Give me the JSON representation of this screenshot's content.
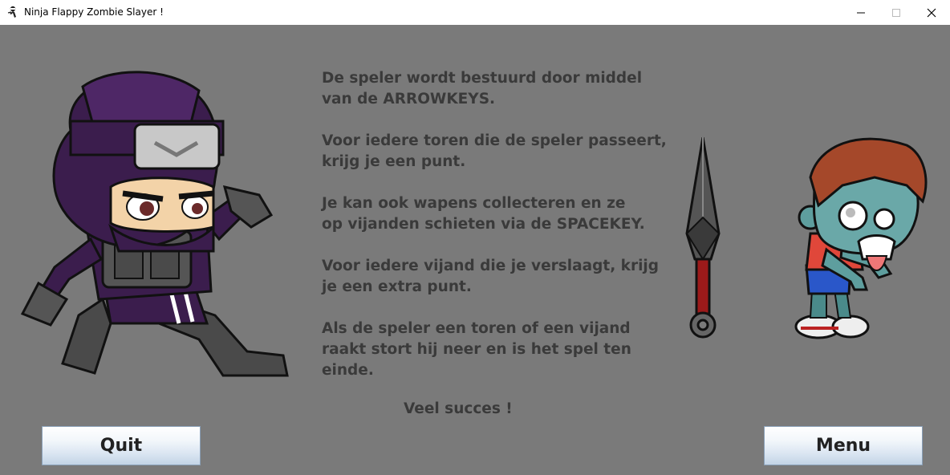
{
  "window": {
    "title": "Ninja Flappy Zombie Slayer !",
    "icon": "ninja-app-icon"
  },
  "instructions": {
    "p1_line1": "De speler wordt bestuurd door middel",
    "p1_line2": "van de ARROWKEYS.",
    "p2_line1": "Voor iedere toren die de speler passeert,",
    "p2_line2": "krijg je een punt.",
    "p3_line1": "Je kan ook wapens collecteren en ze",
    "p3_line2": "op vijanden schieten via de SPACEKEY.",
    "p4_line1": "Voor iedere vijand die je verslaagt, krijg",
    "p4_line2": "je een extra punt.",
    "p5_line1": "Als de speler een toren of een vijand",
    "p5_line2": "raakt stort hij neer en is het spel ten",
    "p5_line3": "einde.",
    "closing": "Veel succes !"
  },
  "buttons": {
    "quit": "Quit",
    "menu": "Menu"
  },
  "colors": {
    "background": "#7a7a7a",
    "text": "#3a3a3a"
  }
}
